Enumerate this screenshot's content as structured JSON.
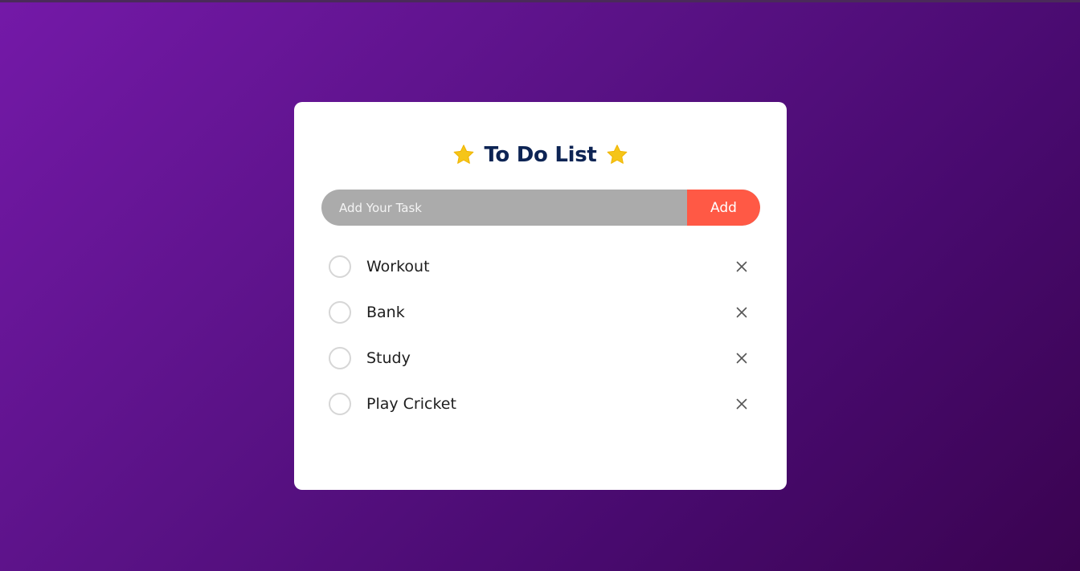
{
  "header": {
    "title": "To Do List",
    "left_icon": "star-icon",
    "right_icon": "star-icon",
    "star_color": "#f5c518",
    "title_color": "#0d2454"
  },
  "input": {
    "placeholder": "Add Your Task",
    "value": ""
  },
  "add_button": {
    "label": "Add",
    "color": "#ff5945"
  },
  "tasks": [
    {
      "label": "Workout",
      "checked": false,
      "delete_icon": "close-icon"
    },
    {
      "label": "Bank",
      "checked": false,
      "delete_icon": "close-icon"
    },
    {
      "label": "Study",
      "checked": false,
      "delete_icon": "close-icon"
    },
    {
      "label": "Play Cricket",
      "checked": false,
      "delete_icon": "close-icon"
    }
  ],
  "colors": {
    "background_start": "#7419a8",
    "background_end": "#3a0350",
    "card": "#ffffff",
    "input_bg": "#ababab"
  }
}
